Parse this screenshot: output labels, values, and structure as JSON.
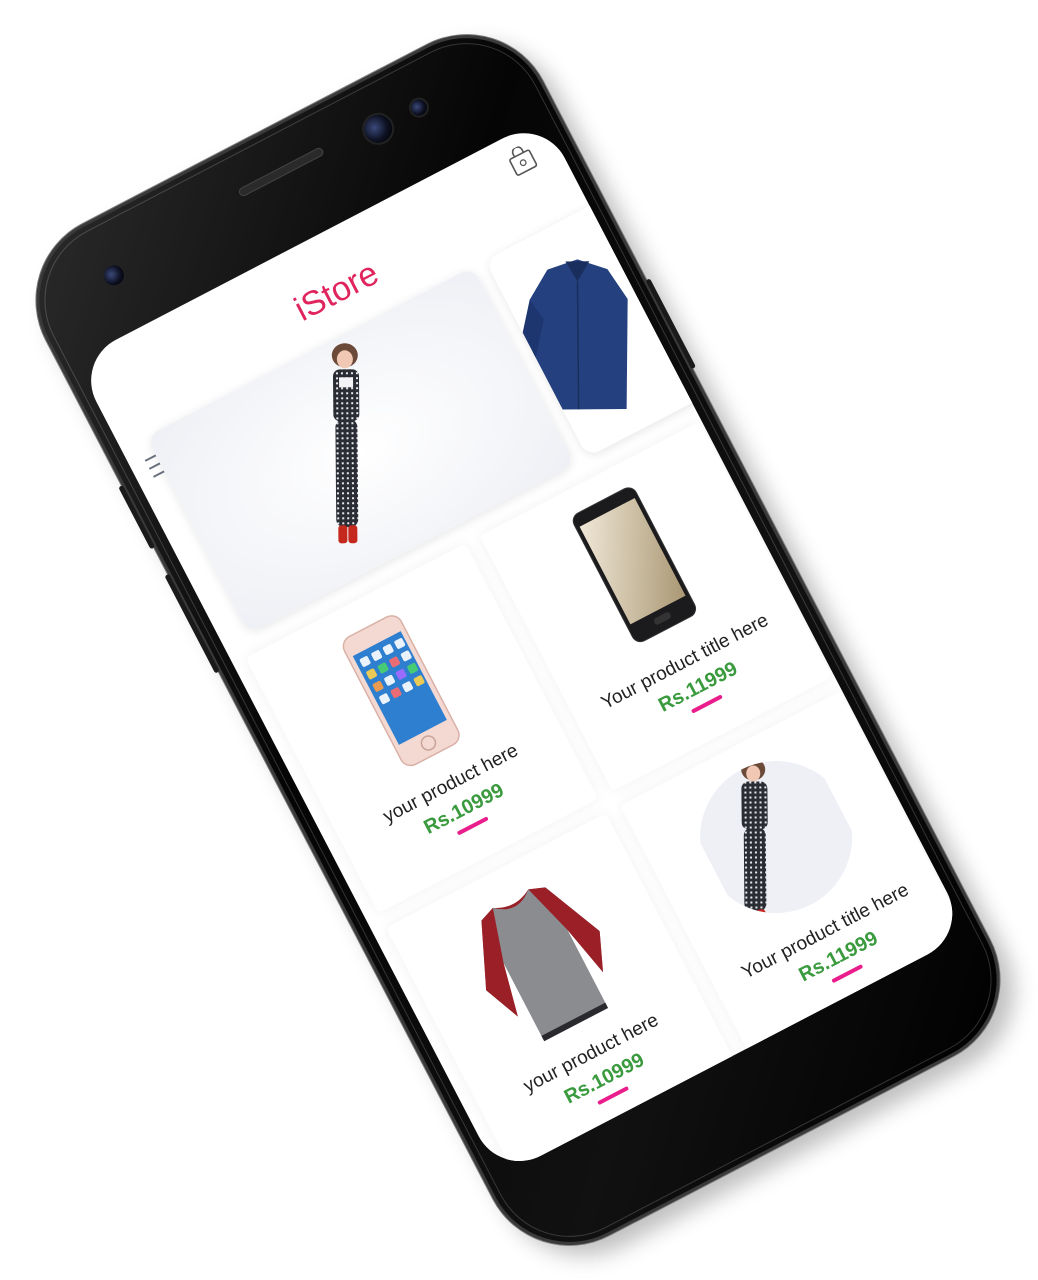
{
  "app": {
    "title": "iStore",
    "title_color": "#e0245e"
  },
  "header": {
    "menu_icon": "hamburger-menu-icon",
    "cart_icon": "shopping-bag-icon"
  },
  "banners": [
    {
      "name": "woman in houndstooth outfit with red boots"
    },
    {
      "name": "navy blue shirt"
    }
  ],
  "products": [
    {
      "title": "your product here",
      "price": "Rs.10999",
      "image": "iphone-product-image"
    },
    {
      "title": "Your product title here",
      "price": "Rs.11999",
      "image": "samsung-phone-product-image"
    },
    {
      "title": "your product here",
      "price": "Rs.10999",
      "image": "raglan-tshirt-product-image"
    },
    {
      "title": "Your product title here",
      "price": "Rs.11999",
      "image": "fashion-model-product-image"
    }
  ],
  "colors": {
    "price": "#3a9a3e",
    "underline": "#e91e8c",
    "phone_body": "#000000"
  }
}
